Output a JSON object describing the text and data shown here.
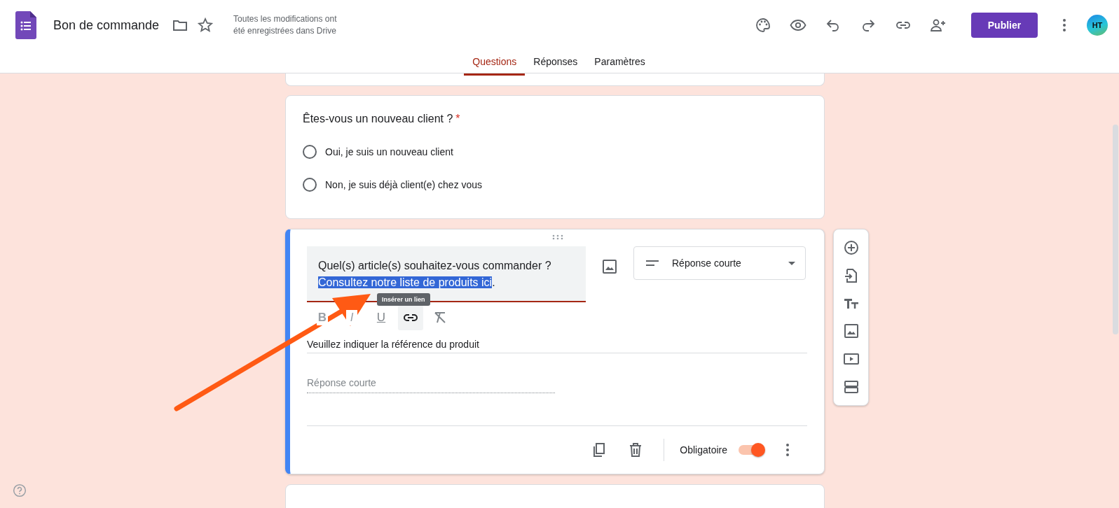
{
  "header": {
    "title": "Bon de commande",
    "save_status": "Toutes les modifications ont été enregistrées dans Drive",
    "publish_button": "Publier",
    "avatar": "HT"
  },
  "tabs": [
    {
      "label": "Questions",
      "selected": true
    },
    {
      "label": "Réponses",
      "selected": false
    },
    {
      "label": "Paramètres",
      "selected": false
    }
  ],
  "questions": [
    {
      "title": "Êtes-vous un nouveau client ?",
      "required_mark": "*",
      "options": [
        {
          "label": "Oui, je suis un nouveau client",
          "selected": false
        },
        {
          "label": "Non, je suis déjà client(e) chez vous",
          "selected": false
        }
      ]
    }
  ],
  "active_question": {
    "title": "Quel(s) article(s) souhaitez-vous commander ?",
    "selected_text": "Consultez notre liste de produits ici",
    "trailing_text": ".",
    "format_buttons": [
      "B",
      "I",
      "U"
    ],
    "tooltip": "Insérer un lien",
    "type_dropdown": "Réponse courte",
    "description": "Veuillez indiquer la référence du produit",
    "answer_placeholder": "Réponse courte",
    "required_label": "Obligatoire",
    "required": true
  }
}
